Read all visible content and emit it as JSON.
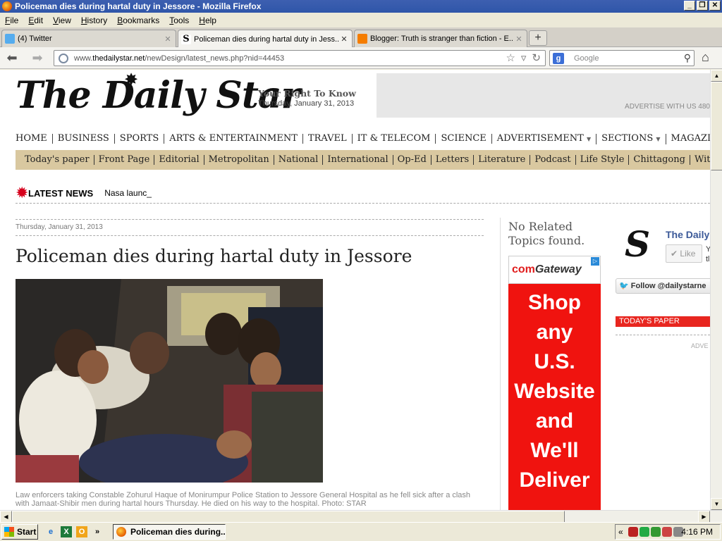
{
  "window": {
    "title": "Policeman dies during hartal duty in Jessore - Mozilla Firefox",
    "buttons": [
      "_",
      "❐",
      "✕"
    ]
  },
  "menu": [
    "File",
    "Edit",
    "View",
    "History",
    "Bookmarks",
    "Tools",
    "Help"
  ],
  "tabs": [
    {
      "label": "(4) Twitter",
      "icon": "twitter-icon"
    },
    {
      "label": "Policeman dies during hartal duty in Jess...",
      "icon": "daily-star-icon",
      "active": true
    },
    {
      "label": "Blogger: Truth is stranger than fiction - E...",
      "icon": "blogger-icon"
    }
  ],
  "newtab_label": "+",
  "nav": {
    "url_prefix": "www.",
    "url_domain": "thedailystar.net",
    "url_path": "/newDesign/latest_news.php?nid=44453",
    "search_placeholder": "Google"
  },
  "masthead": {
    "logo": "The Daily Star",
    "tagline": "Your Right To Know",
    "date": "Thursday, January 31, 2013",
    "ad_text": "ADVERTISE WITH US 480"
  },
  "main_nav": [
    {
      "label": "HOME"
    },
    {
      "label": "BUSINESS"
    },
    {
      "label": "SPORTS"
    },
    {
      "label": "ARTS & ENTERTAINMENT"
    },
    {
      "label": "TRAVEL"
    },
    {
      "label": "IT & TELECOM"
    },
    {
      "label": "SCIENCE"
    },
    {
      "label": "ADVERTISEMENT",
      "dropdown": true
    },
    {
      "label": "SECTIONS",
      "dropdown": true
    },
    {
      "label": "MAGAZINES",
      "dropdown": true
    }
  ],
  "sub_nav": [
    "Today's paper",
    "Front Page",
    "Editorial",
    "Metropolitan",
    "National",
    "International",
    "Op-Ed",
    "Letters",
    "Literature",
    "Podcast",
    "Life Style",
    "Chittagong",
    "Witness"
  ],
  "latest_news": {
    "label": "LATEST NEWS",
    "ticker": "Nasa launc_"
  },
  "article": {
    "date": "Thursday, January 31, 2013",
    "headline": "Policeman dies during hartal duty in Jessore",
    "caption": "Law enforcers taking Constable Zohurul Haque of Monirumpur Police Station to Jessore General Hospital as he fell sick after a clash with Jamaat-Shibir men during hartal hours Thursday. He died on his way to the hospital. Photo: STAR"
  },
  "sidebar": {
    "no_related": "No Related Topics found.",
    "ad": {
      "brand_com": "com",
      "brand_gateway": "Gateway",
      "lines": [
        "Shop",
        "any",
        "U.S.",
        "Website",
        "and",
        "We'll",
        "Deliver"
      ]
    },
    "fb": {
      "name": "The Daily",
      "like": "Like",
      "side_text_1": "Y",
      "side_text_2": "tl"
    },
    "twitter_follow": "Follow @dailystarne",
    "todays_paper": "TODAY'S PAPER",
    "adve": "ADVE"
  },
  "taskbar": {
    "start": "Start",
    "more": "»",
    "task": "Policeman dies during...",
    "tray_chevron": "«",
    "clock": "4:16 PM"
  }
}
